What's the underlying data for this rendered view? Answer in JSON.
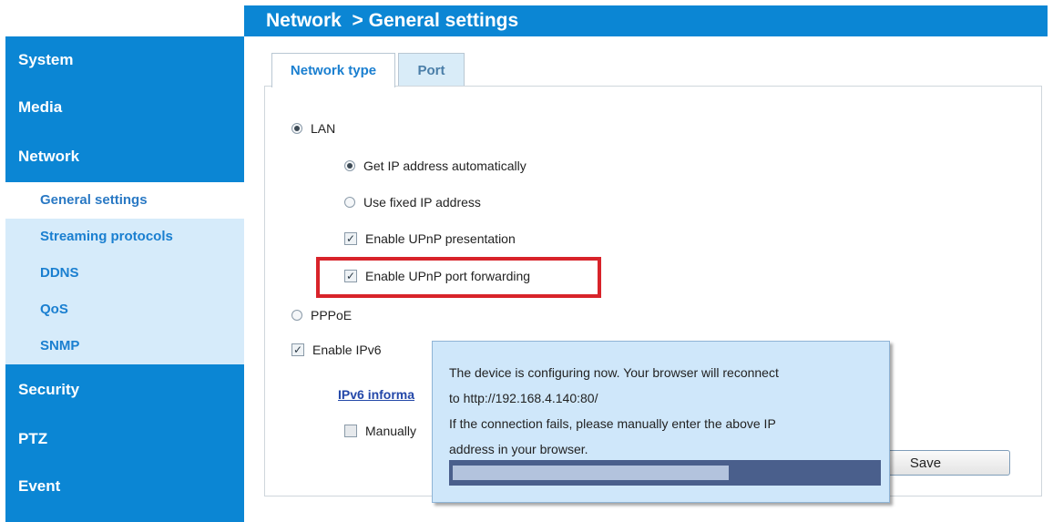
{
  "header": {
    "title": "Network  > General settings"
  },
  "sidebar": {
    "items": [
      "System",
      "Media",
      "Network",
      "Security",
      "PTZ",
      "Event"
    ],
    "subitems": [
      "General settings",
      "Streaming protocols",
      "DDNS",
      "QoS",
      "SNMP"
    ]
  },
  "tabs": [
    "Network type",
    "Port"
  ],
  "form": {
    "lan_label": "LAN",
    "get_ip_auto": "Get IP address automatically",
    "use_fixed_ip": "Use fixed IP address",
    "upnp_presentation": "Enable UPnP presentation",
    "upnp_port_forwarding": "Enable UPnP port forwarding",
    "pppoe_label": "PPPoE",
    "enable_ipv6": "Enable IPv6",
    "ipv6_info_link": "IPv6 informa",
    "manually_label": "Manually",
    "save_label": "Save"
  },
  "popup": {
    "line1": "The device is configuring now. Your browser will reconnect",
    "line2": "to http://192.168.4.140:80/",
    "line3": "If the connection fails, please manually enter the above IP",
    "line4": "address in your browser.",
    "progress_fraction": 0.65
  },
  "colors": {
    "accent": "#0b86d4",
    "highlight": "#d8232a",
    "popup_bg": "#cfe7fa"
  }
}
